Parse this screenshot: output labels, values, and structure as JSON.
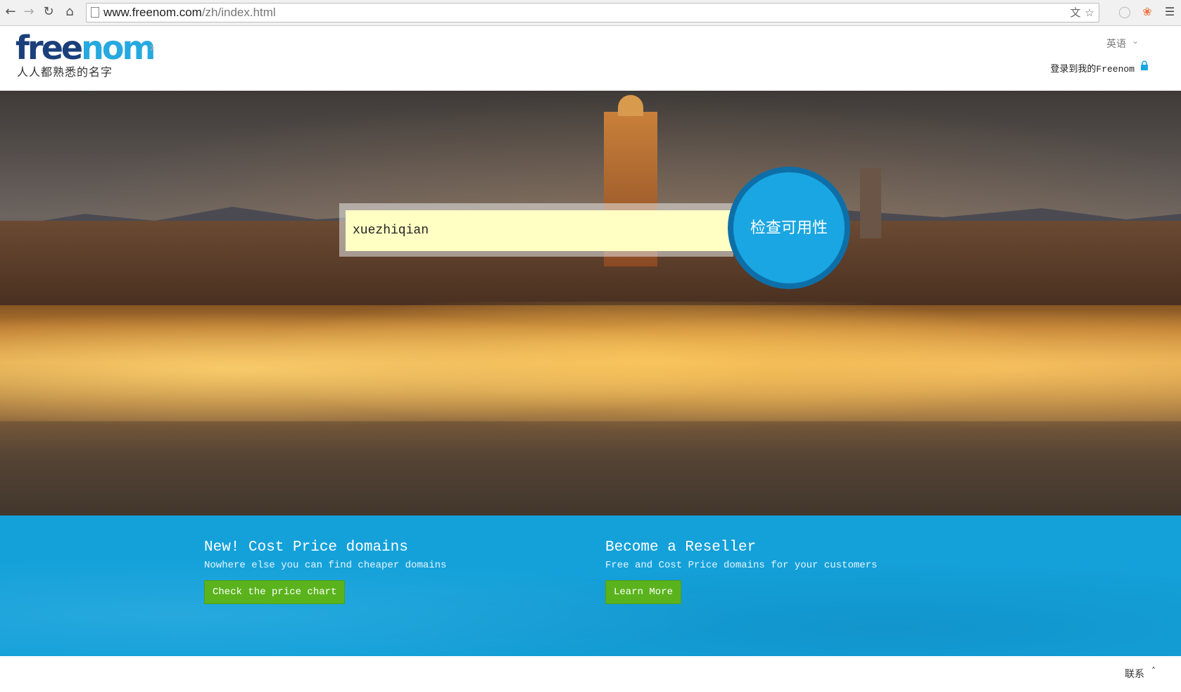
{
  "browser": {
    "url_host": "www.freenom.com",
    "url_path": "/zh/index.html",
    "icons": [
      "back-icon",
      "forward-icon",
      "reload-icon",
      "home-icon",
      "page-icon",
      "translate-icon",
      "star-icon",
      "shield-icon",
      "chrome-ext-icon",
      "menu-icon"
    ]
  },
  "header": {
    "logo_free": "free",
    "logo_nom": "nom",
    "tagline": "人人都熟悉的名字",
    "language": "英语",
    "login": "登录到我的Freenom"
  },
  "hero": {
    "search_value": "xuezhiqian",
    "check_button": "检查可用性"
  },
  "promos": [
    {
      "title": "New! Cost Price domains",
      "subtitle": "Nowhere else you can find cheaper domains",
      "button": "Check the price chart"
    },
    {
      "title": "Become a Reseller",
      "subtitle": "Free and Cost Price domains for your customers",
      "button": "Learn More"
    }
  ],
  "footer": {
    "contact": "联系"
  },
  "colors": {
    "brand_dark": "#1b3f7a",
    "brand_light": "#26a9e0",
    "promo_bg": "#14a1da",
    "promo_button": "#5ab31c",
    "search_bg": "#ffffc4"
  }
}
